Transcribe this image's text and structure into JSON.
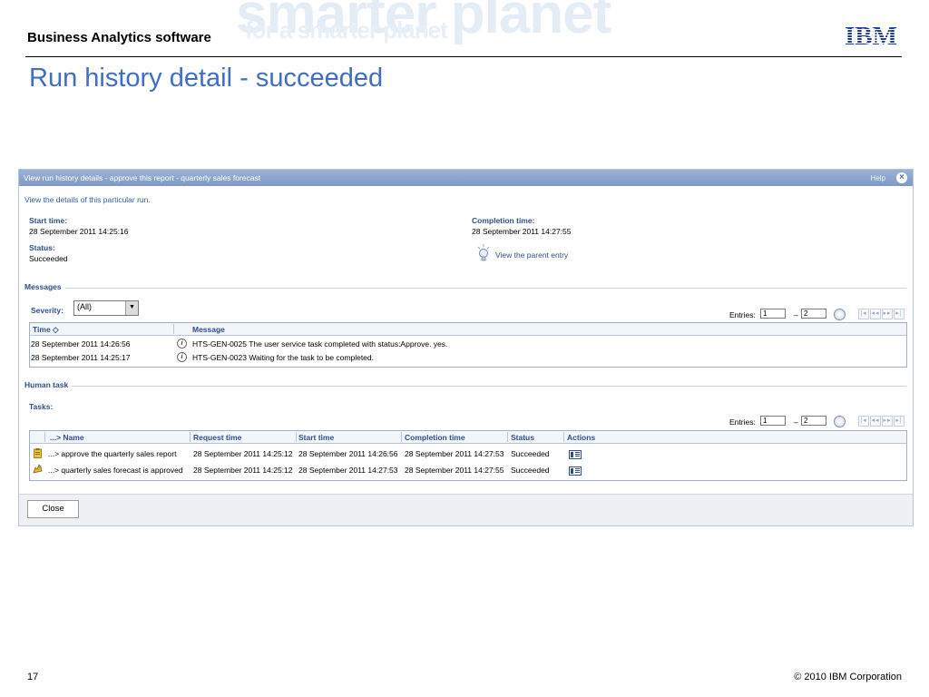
{
  "slide": {
    "header_title": "Business Analytics software",
    "title": "Run history detail - succeeded",
    "watermark_line1": "smarter planet",
    "watermark_line2": "for a smarter planet",
    "page_number": "17",
    "copyright": "© 2010 IBM Corporation",
    "logo_text": "IBM"
  },
  "dialog": {
    "title": "View run history details - approve this report - quarterly sales forecast",
    "help": "Help",
    "description": "View the details of this particular run.",
    "start_time_label": "Start time:",
    "start_time": "28 September 2011 14:25:16",
    "status_label": "Status:",
    "status": "Succeeded",
    "completion_time_label": "Completion time:",
    "completion_time": "28 September 2011 14:27:55",
    "parent_entry_link": "View the parent entry",
    "close_label": "Close"
  },
  "messages": {
    "section_label": "Messages",
    "severity_label": "Severity:",
    "severity_value": "(All)",
    "entries_label": "Entries:",
    "entries_from": "1",
    "entries_dash": "–",
    "entries_to": "2",
    "columns": [
      "Time ◇",
      "Message"
    ],
    "rows": [
      {
        "time": "28 September 2011 14:26:56",
        "message": "HTS-GEN-0025 The user service task completed with status:Approve. yes."
      },
      {
        "time": "28 September 2011 14:25:17",
        "message": "HTS-GEN-0023 Waiting for the task to be completed."
      }
    ]
  },
  "human_task": {
    "section_label": "Human task",
    "tasks_label": "Tasks:",
    "entries_label": "Entries:",
    "entries_from": "1",
    "entries_dash": "–",
    "entries_to": "2",
    "columns": [
      "...> Name",
      "Request time",
      "Start time",
      "Completion time",
      "Status",
      "Actions"
    ],
    "rows": [
      {
        "name": "...> approve the quarterly sales report",
        "request": "28 September 2011 14:25:12",
        "start": "28 September 2011 14:26:56",
        "completion": "28 September 2011 14:27:53",
        "status": "Succeeded"
      },
      {
        "name": "...> quarterly sales forecast is approved",
        "request": "28 September 2011 14:25:12",
        "start": "28 September 2011 14:27:53",
        "completion": "28 September 2011 14:27:55",
        "status": "Succeeded"
      }
    ]
  },
  "colors": {
    "title_blue": "#3f6ec5",
    "titlebar": "#8aa2cd",
    "label_blue": "#2e4f8c"
  }
}
